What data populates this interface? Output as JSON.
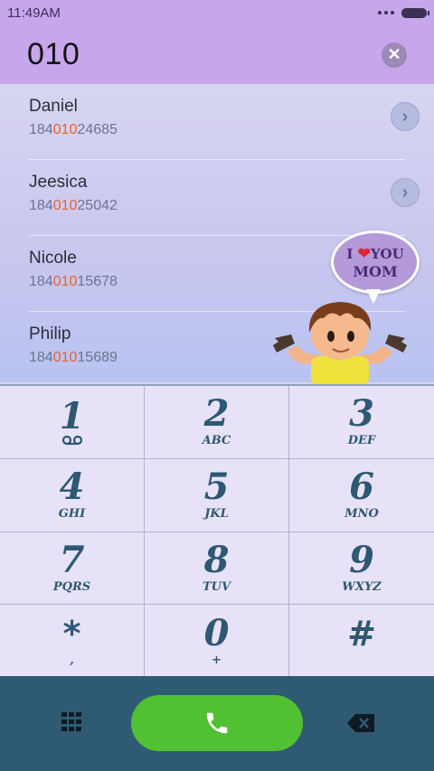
{
  "status_bar": {
    "time": "11:49AM"
  },
  "dialer": {
    "input_value": "010"
  },
  "results": [
    {
      "name": "Daniel",
      "phone_prefix": "184",
      "phone_match": "010",
      "phone_suffix": "24685"
    },
    {
      "name": "Jeesica",
      "phone_prefix": "184",
      "phone_match": "010",
      "phone_suffix": "25042"
    },
    {
      "name": "Nicole",
      "phone_prefix": "184",
      "phone_match": "010",
      "phone_suffix": "15678"
    },
    {
      "name": "Philip",
      "phone_prefix": "184",
      "phone_match": "010",
      "phone_suffix": "15689"
    }
  ],
  "decoration": {
    "bubble_line1_a": "I",
    "bubble_line1_b": "YOU",
    "bubble_line2": "MOM"
  },
  "keypad": [
    {
      "digit": "1",
      "letters": "",
      "voicemail": true
    },
    {
      "digit": "2",
      "letters": "ABC"
    },
    {
      "digit": "3",
      "letters": "DEF"
    },
    {
      "digit": "4",
      "letters": "GHI"
    },
    {
      "digit": "5",
      "letters": "JKL"
    },
    {
      "digit": "6",
      "letters": "MNO"
    },
    {
      "digit": "7",
      "letters": "PQRS"
    },
    {
      "digit": "8",
      "letters": "TUV"
    },
    {
      "digit": "9",
      "letters": "WXYZ"
    },
    {
      "digit": "*",
      "letters": ","
    },
    {
      "digit": "0",
      "letters": "+"
    },
    {
      "digit": "#",
      "letters": ""
    }
  ],
  "colors": {
    "accent": "#c7a6ec",
    "call": "#52c033",
    "bottom_bar": "#2f5a73",
    "key_text": "#2e5873",
    "highlight": "#e9622b"
  },
  "icons": {
    "clear": "close-icon",
    "call": "phone-icon",
    "keypad": "keypad-grid-icon",
    "backspace": "backspace-icon",
    "voicemail": "voicemail-icon"
  }
}
